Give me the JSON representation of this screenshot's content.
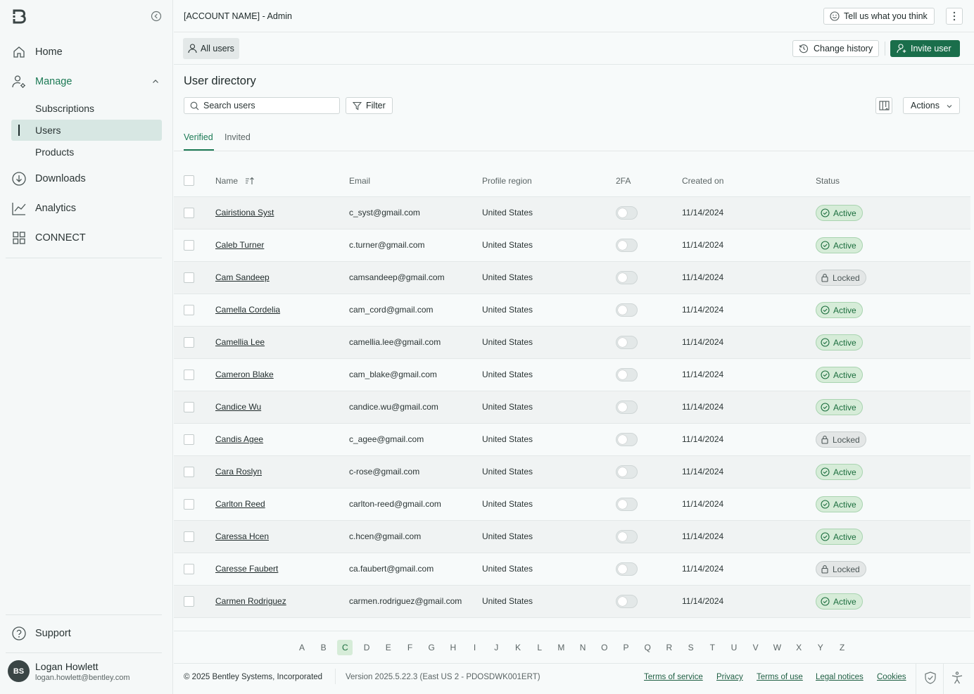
{
  "sidebar": {
    "nav": [
      {
        "label": "Home",
        "icon": "home-icon"
      },
      {
        "label": "Manage",
        "icon": "user-gear-icon"
      },
      {
        "label": "Downloads",
        "icon": "download-icon"
      },
      {
        "label": "Analytics",
        "icon": "chart-icon"
      },
      {
        "label": "CONNECT",
        "icon": "grid-icon"
      }
    ],
    "manage_items": [
      "Subscriptions",
      "Users",
      "Products"
    ],
    "support": "Support",
    "user": {
      "initials": "BS",
      "name": "Logan Howlett",
      "email": "logan.howlett@bentley.com"
    }
  },
  "header": {
    "account": "[ACCOUNT NAME] - Admin",
    "feedback": "Tell us what you think"
  },
  "subheader": {
    "all_users": "All users",
    "change_history": "Change history",
    "invite_user": "Invite user"
  },
  "directory": {
    "title": "User directory",
    "search_placeholder": "Search users",
    "filter": "Filter",
    "actions": "Actions",
    "tabs": [
      "Verified",
      "Invited"
    ],
    "columns": [
      "Name",
      "Email",
      "Profile region",
      "2FA",
      "Created on",
      "Status"
    ],
    "rows": [
      {
        "name": "Cairistiona Syst",
        "email": "c_syst@gmail.com",
        "region": "United States",
        "created": "11/14/2024",
        "status": "Active"
      },
      {
        "name": "Caleb Turner",
        "email": "c.turner@gmail.com",
        "region": "United States",
        "created": "11/14/2024",
        "status": "Active"
      },
      {
        "name": "Cam Sandeep",
        "email": "camsandeep@gmail.com",
        "region": "United States",
        "created": "11/14/2024",
        "status": "Locked"
      },
      {
        "name": "Camella Cordelia",
        "email": "cam_cord@gmail.com",
        "region": "United States",
        "created": "11/14/2024",
        "status": "Active"
      },
      {
        "name": "Camellia Lee",
        "email": "camellia.lee@gmail.com",
        "region": "United States",
        "created": "11/14/2024",
        "status": "Active"
      },
      {
        "name": "Cameron Blake",
        "email": "cam_blake@gmail.com",
        "region": "United States",
        "created": "11/14/2024",
        "status": "Active"
      },
      {
        "name": "Candice Wu",
        "email": "candice.wu@gmail.com",
        "region": "United States",
        "created": "11/14/2024",
        "status": "Active"
      },
      {
        "name": "Candis Agee",
        "email": "c_agee@gmail.com",
        "region": "United States",
        "created": "11/14/2024",
        "status": "Locked"
      },
      {
        "name": "Cara Roslyn",
        "email": "c-rose@gmail.com",
        "region": "United States",
        "created": "11/14/2024",
        "status": "Active"
      },
      {
        "name": "Carlton Reed",
        "email": "carlton-reed@gmail.com",
        "region": "United States",
        "created": "11/14/2024",
        "status": "Active"
      },
      {
        "name": "Caressa Hcen",
        "email": "c.hcen@gmail.com",
        "region": "United States",
        "created": "11/14/2024",
        "status": "Active"
      },
      {
        "name": "Caresse Faubert",
        "email": "ca.faubert@gmail.com",
        "region": "United States",
        "created": "11/14/2024",
        "status": "Locked"
      },
      {
        "name": "Carmen Rodriguez",
        "email": "carmen.rodriguez@gmail.com",
        "region": "United States",
        "created": "11/14/2024",
        "status": "Active"
      }
    ]
  },
  "alphabet": {
    "letters": [
      "A",
      "B",
      "C",
      "D",
      "E",
      "F",
      "G",
      "H",
      "I",
      "J",
      "K",
      "L",
      "M",
      "N",
      "O",
      "P",
      "Q",
      "R",
      "S",
      "T",
      "U",
      "V",
      "W",
      "X",
      "Y",
      "Z"
    ],
    "selected": "C"
  },
  "footer": {
    "copyright": "© 2025 Bentley Systems, Incorporated",
    "version": "Version 2025.5.22.3 (East US 2 - PDOSDWK001ERT)",
    "links": [
      "Terms of service",
      "Privacy",
      "Terms of use",
      "Legal notices",
      "Cookies"
    ]
  },
  "colors": {
    "accent": "#1a6e4b",
    "active_badge": "#d6ecd8",
    "locked_badge": "#e3e6e6"
  }
}
